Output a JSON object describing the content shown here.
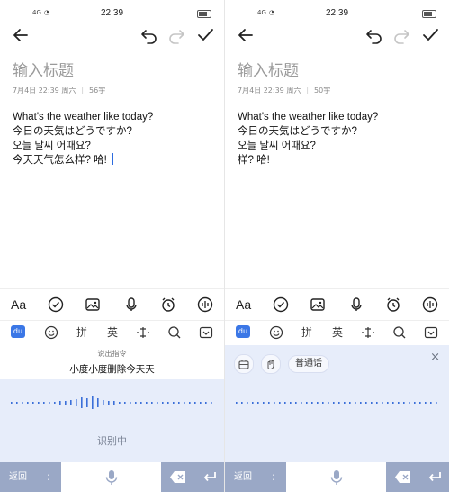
{
  "left": {
    "status": {
      "time": "22:39",
      "signal": "4G"
    },
    "title_placeholder": "输入标题",
    "meta": {
      "date": "7月4日 22:39 周六",
      "count": "56字"
    },
    "lines": [
      "What's the weather like today?",
      "今日の天気はどうですか?",
      "오늘 날씨 어때요?",
      "今天天气怎么样? 哈!"
    ],
    "toolbar": {
      "format_label": "Aa"
    },
    "ime": {
      "pinyin": "拼",
      "english": "英"
    },
    "voice": {
      "hint": "说出指令",
      "command": "小度小度删除今天天",
      "recognizing": "识别中"
    },
    "keys": {
      "back": "返回",
      "dot": ":"
    }
  },
  "right": {
    "status": {
      "time": "22:39",
      "signal": "4G"
    },
    "title_placeholder": "输入标题",
    "meta": {
      "date": "7月4日 22:39 周六",
      "count": "50字"
    },
    "lines": [
      "What's the weather like today?",
      "今日の天気はどうですか?",
      "오늘 날씨 어때요?",
      "样? 哈!"
    ],
    "toolbar": {
      "format_label": "Aa"
    },
    "ime": {
      "pinyin": "拼",
      "english": "英"
    },
    "voice": {
      "chip": "普通话",
      "close": "×"
    },
    "keys": {
      "back": "返回",
      "dot": ":"
    }
  },
  "colors": {
    "accent": "#2d6cdf",
    "voice_bg": "#e7edfa",
    "key_bg": "#9aa8c6"
  }
}
